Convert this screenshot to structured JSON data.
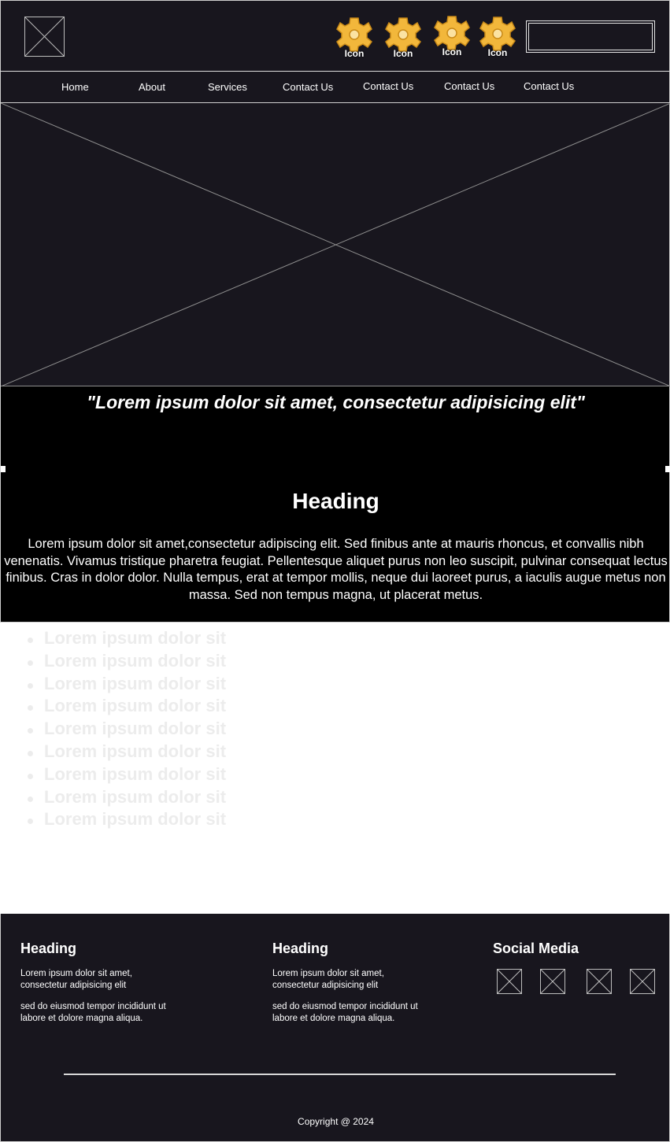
{
  "header": {
    "icons": [
      {
        "icon": "gear-icon",
        "label": "Icon"
      },
      {
        "icon": "gear-icon",
        "label": "Icon"
      },
      {
        "icon": "gear-icon",
        "label": "Icon"
      },
      {
        "icon": "gear-icon",
        "label": "Icon"
      }
    ]
  },
  "nav": {
    "items": [
      "Home",
      "About",
      "Services",
      "Contact Us",
      "Contact Us",
      "Contact Us",
      "Contact Us"
    ]
  },
  "content": {
    "quote": "\"Lorem ipsum dolor sit amet, consectetur adipisicing elit\"",
    "heading": "Heading",
    "paragraph": "Lorem ipsum dolor sit amet,consectetur adipiscing elit. Sed finibus ante at mauris rhoncus, et convallis nibh venenatis. Vivamus tristique pharetra feugiat. Pellentesque aliquet purus non leo suscipit, pulvinar consequat lectus finibus. Cras in dolor dolor. Nulla tempus, erat at tempor mollis, neque dui laoreet purus, a iaculis augue metus non massa. Sed non tempus magna, ut placerat metus."
  },
  "list": {
    "items": [
      "Lorem ipsum dolor sit",
      "Lorem ipsum dolor sit",
      "Lorem ipsum dolor sit",
      "Lorem ipsum dolor sit",
      "Lorem ipsum dolor sit",
      "Lorem ipsum dolor sit",
      "Lorem ipsum dolor sit",
      "Lorem ipsum dolor sit",
      "Lorem ipsum dolor sit"
    ]
  },
  "footer": {
    "col1": {
      "heading": "Heading",
      "text1": "Lorem ipsum dolor sit amet, consectetur adipisicing elit",
      "text2": "sed do eiusmod tempor incididunt ut labore et dolore magna aliqua."
    },
    "col2": {
      "heading": "Heading",
      "text1": "Lorem ipsum dolor sit amet, consectetur adipisicing elit",
      "text2": "sed do eiusmod tempor incididunt ut labore et dolore magna aliqua."
    },
    "social": {
      "heading": "Social Media"
    },
    "copyright": "Copyright @ 2024"
  },
  "colors": {
    "background_dark": "#18161e",
    "content_black": "#000000",
    "icon_gold": "#f5b93a",
    "list_text": "#ececec"
  }
}
